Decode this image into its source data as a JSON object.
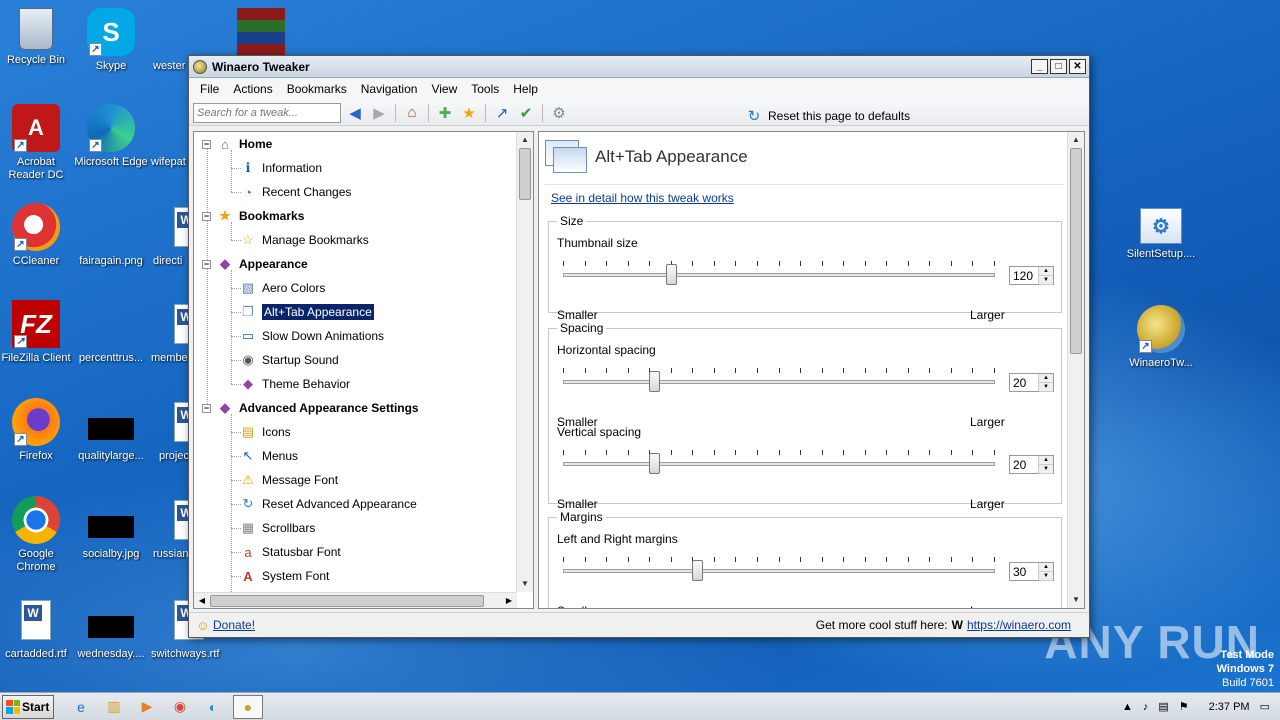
{
  "desktop": {
    "icons": [
      {
        "label": "Recycle Bin",
        "icon": "recycle-bin-icon"
      },
      {
        "label": "Skype",
        "icon": "skype-icon"
      },
      {
        "label": "wester",
        "icon": "winrar-icon"
      },
      {
        "label": "Acrobat Reader DC",
        "icon": "acrobat-icon"
      },
      {
        "label": "Microsoft Edge",
        "icon": "edge-icon"
      },
      {
        "label": "wifepat",
        "icon": "file-icon"
      },
      {
        "label": "CCleaner",
        "icon": "ccleaner-icon"
      },
      {
        "label": "fairagain.png",
        "icon": "image-file-icon"
      },
      {
        "label": "directi",
        "icon": "word-doc-icon"
      },
      {
        "label": "FileZilla Client",
        "icon": "filezilla-icon"
      },
      {
        "label": "percenttrus...",
        "icon": "image-file-icon"
      },
      {
        "label": "member",
        "icon": "word-doc-icon"
      },
      {
        "label": "Firefox",
        "icon": "firefox-icon"
      },
      {
        "label": "qualitylarge...",
        "icon": "image-file-icon"
      },
      {
        "label": "projec",
        "icon": "word-doc-icon"
      },
      {
        "label": "Google Chrome",
        "icon": "chrome-icon"
      },
      {
        "label": "socialby.jpg",
        "icon": "image-file-icon"
      },
      {
        "label": "russian",
        "icon": "word-doc-icon"
      },
      {
        "label": "cartadded.rtf",
        "icon": "rtf-file-icon"
      },
      {
        "label": "wednesday....",
        "icon": "image-file-icon"
      },
      {
        "label": "switchways.rtf",
        "icon": "word-doc-icon"
      },
      {
        "label": "SilentSetup....",
        "icon": "setup-icon"
      },
      {
        "label": "WinaeroTw...",
        "icon": "winaero-icon"
      }
    ],
    "watermark": "ANY RUN",
    "test_mode": {
      "line1": "Test Mode",
      "line2": "Windows 7",
      "line3": "Build 7601"
    }
  },
  "window": {
    "title": "Winaero Tweaker",
    "menu": [
      "File",
      "Actions",
      "Bookmarks",
      "Navigation",
      "View",
      "Tools",
      "Help"
    ],
    "search_placeholder": "Search for a tweak...",
    "reset_label": "Reset this page to defaults",
    "tree": {
      "home": "Home",
      "information": "Information",
      "recent_changes": "Recent Changes",
      "bookmarks": "Bookmarks",
      "manage_bookmarks": "Manage Bookmarks",
      "appearance": "Appearance",
      "aero_colors": "Aero Colors",
      "alt_tab": "Alt+Tab Appearance",
      "slow_down": "Slow Down Animations",
      "startup_sound": "Startup Sound",
      "theme_behavior": "Theme Behavior",
      "advanced": "Advanced Appearance Settings",
      "icons": "Icons",
      "menus": "Menus",
      "message_font": "Message Font",
      "reset_advanced": "Reset Advanced Appearance",
      "scrollbars": "Scrollbars",
      "statusbar_font": "Statusbar Font",
      "system_font": "System Font"
    },
    "page": {
      "title": "Alt+Tab Appearance",
      "detail_link": "See in detail how this tweak works",
      "size_group": "Size",
      "thumbnail_size": {
        "label": "Thumbnail size",
        "value": "120",
        "level": 0.25
      },
      "spacing_group": "Spacing",
      "horizontal_spacing": {
        "label": "Horizontal spacing",
        "value": "20",
        "level": 0.21
      },
      "vertical_spacing": {
        "label": "Vertical spacing",
        "value": "20",
        "level": 0.21
      },
      "margins_group": "Margins",
      "lr_margins": {
        "label": "Left and Right margins",
        "value": "30",
        "level": 0.31
      },
      "smaller": "Smaller",
      "larger": "Larger"
    },
    "status": {
      "donate": "Donate!",
      "more": "Get more cool stuff here:",
      "url": "https://winaero.com"
    }
  },
  "taskbar": {
    "start": "Start",
    "time": "2:37 PM"
  }
}
